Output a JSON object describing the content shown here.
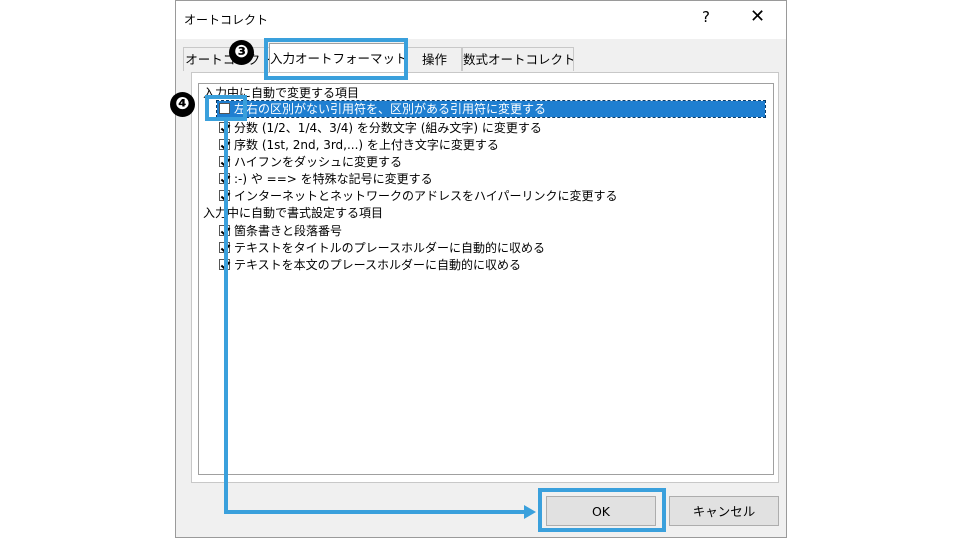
{
  "dialog": {
    "title": "オートコレクト",
    "help_label": "?",
    "close_label": "✕"
  },
  "tabs": [
    {
      "label": "オートコレクト",
      "active": false
    },
    {
      "label": "入力オートフォーマット",
      "active": true
    },
    {
      "label": "操作",
      "active": false
    },
    {
      "label": "数式オートコレクト",
      "active": false
    }
  ],
  "groups": [
    {
      "label": "入力中に自動で変更する項目",
      "items": [
        {
          "label": "左右の区別がない引用符を、区別がある引用符に変更する",
          "checked": false,
          "selected": true
        },
        {
          "label": "分数 (1/2、1/4、3/4) を分数文字 (組み文字) に変更する",
          "checked": true,
          "selected": false
        },
        {
          "label": "序数 (1st, 2nd, 3rd,...) を上付き文字に変更する",
          "checked": true,
          "selected": false
        },
        {
          "label": "ハイフンをダッシュに変更する",
          "checked": true,
          "selected": false
        },
        {
          "label": ":-) や ==> を特殊な記号に変更する",
          "checked": true,
          "selected": false
        },
        {
          "label": "インターネットとネットワークのアドレスをハイパーリンクに変更する",
          "checked": true,
          "selected": false
        }
      ]
    },
    {
      "label": "入力中に自動で書式設定する項目",
      "items": [
        {
          "label": "箇条書きと段落番号",
          "checked": true,
          "selected": false
        },
        {
          "label": "テキストをタイトルのプレースホルダーに自動的に収める",
          "checked": true,
          "selected": false
        },
        {
          "label": "テキストを本文のプレースホルダーに自動的に収める",
          "checked": true,
          "selected": false
        }
      ]
    }
  ],
  "buttons": {
    "ok_label": "OK",
    "cancel_label": "キャンセル"
  },
  "annotations": {
    "badge_tab": "❸",
    "badge_item": "❹",
    "highlight_color": "#3aa0dc"
  }
}
